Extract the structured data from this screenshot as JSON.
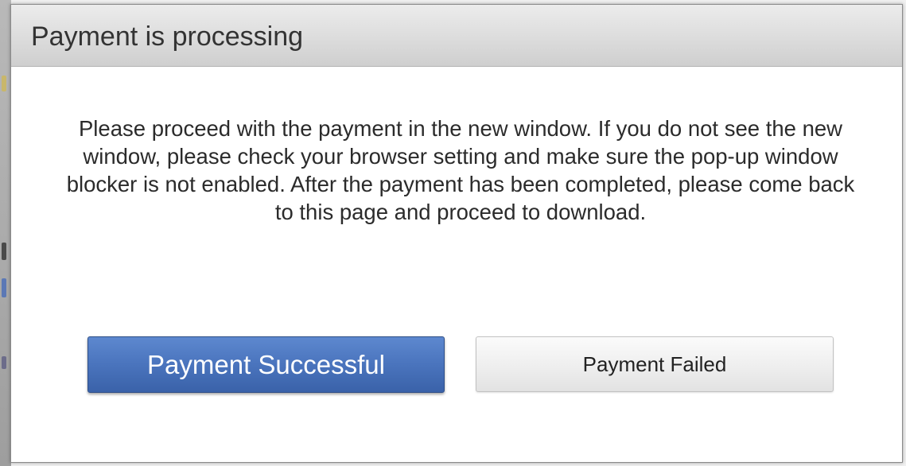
{
  "dialog": {
    "title": "Payment is processing",
    "message": "Please proceed with the payment in the new window. If you do not see the new window, please check your browser setting and make sure the pop-up window blocker is not enabled. After the payment has been completed, please come back to this page and proceed to download.",
    "primary_button_label": "Payment Successful",
    "secondary_button_label": "Payment Failed"
  },
  "colors": {
    "primary_button": "#4a74bd",
    "secondary_button": "#eeeeee",
    "titlebar": "#dcdcdc",
    "text": "#2b2b2b"
  }
}
